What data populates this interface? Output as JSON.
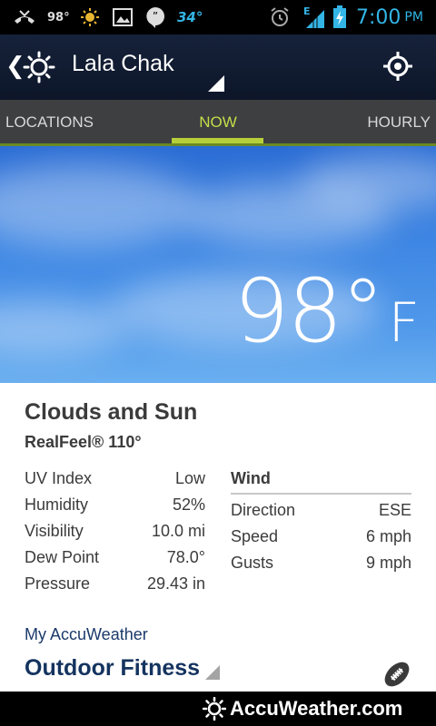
{
  "status_bar": {
    "temp_small": "98°",
    "temp_right": "34°",
    "network": "E",
    "time": "7:00",
    "ampm": "PM",
    "icons": [
      "missed-call-icon",
      "sun-icon",
      "image-icon",
      "hangouts-icon",
      "alarm-icon",
      "signal-icon",
      "battery-charging-icon"
    ]
  },
  "header": {
    "location": "Lala Chak"
  },
  "tabs": [
    {
      "label": "LOCATIONS"
    },
    {
      "label": "NOW",
      "active": true
    },
    {
      "label": "HOURLY"
    }
  ],
  "current": {
    "temperature": "98°",
    "unit": "F",
    "condition": "Clouds and Sun",
    "realfeel": "RealFeel® 110°"
  },
  "details": [
    {
      "label": "UV Index",
      "value": "Low"
    },
    {
      "label": "Humidity",
      "value": "52%"
    },
    {
      "label": "Visibility",
      "value": "10.0 mi"
    },
    {
      "label": "Dew Point",
      "value": "78.0°"
    },
    {
      "label": "Pressure",
      "value": "29.43 in"
    }
  ],
  "wind": {
    "title": "Wind",
    "rows": [
      {
        "label": "Direction",
        "value": "ESE"
      },
      {
        "label": "Speed",
        "value": "6 mph"
      },
      {
        "label": "Gusts",
        "value": "9 mph"
      }
    ]
  },
  "my_accuweather": {
    "heading": "My AccuWeather",
    "activity": "Outdoor Fitness"
  },
  "footer": {
    "brand": "AccuWeather.com"
  },
  "colors": {
    "accent_blue": "#33b5e5",
    "tab_active": "#c5dd4a",
    "sky": "#3e86e3",
    "heading_navy": "#14335f"
  }
}
